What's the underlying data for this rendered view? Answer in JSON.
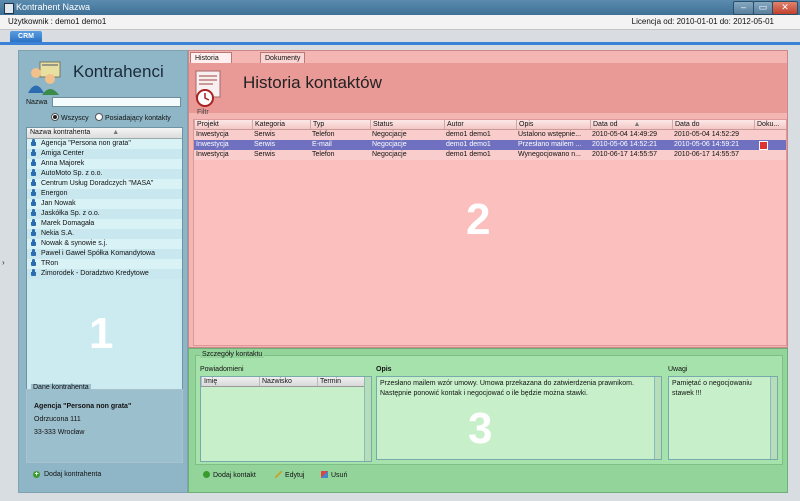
{
  "window": {
    "title": "Kontrahent Nazwa",
    "min": "–",
    "max": "▭",
    "close": "✕"
  },
  "info": {
    "user": "Użytkownik : demo1 demo1",
    "license": "Licencja od: 2010-01-01 do: 2012-05-01"
  },
  "tabs": {
    "crm": "CRM"
  },
  "panel1": {
    "heading": "Kontrahenci",
    "search_label": "Nazwa",
    "search_value": "",
    "radio_all": "Wszyscy",
    "radio_contacts": "Posiadający kontakty",
    "list_header": "Nazwa kontrahenta",
    "sort_icon": "▲",
    "items": [
      "Agencja \"Persona non grata\"",
      "Amiga Center",
      "Anna Majorek",
      "AutoMoto Sp. z o.o.",
      "Centrum Usług Doradczych \"MASA\"",
      "Energon",
      "Jan Nowak",
      "Jaskółka Sp. z o.o.",
      "Marek Domagała",
      "Nekia S.A.",
      "Nowak & synowie s.j.",
      "Paweł i Gaweł Spółka Komandytowa",
      "TRon",
      "Zimorodek - Doradztwo Kredytowe"
    ],
    "number": "1",
    "details_label": "Dane kontrahenta",
    "details_name": "Agencja \"Persona non grata\"",
    "details_street": "Odrzucona 111",
    "details_city": "33-333 Wrocław",
    "add_button": "Dodaj kontrahenta"
  },
  "panel2": {
    "tab_history": "Historia kontaktów",
    "tab_docs": "Dokumenty",
    "heading": "Historia kontaktów",
    "filter_label": "Filtr",
    "sort_icon": "▲",
    "columns": [
      "Projekt",
      "Kategoria",
      "Typ",
      "Status",
      "Autor",
      "Opis",
      "Data od",
      "Data do",
      "Doku..."
    ],
    "rows": [
      [
        "Inwestycja",
        "Serwis",
        "Telefon",
        "Negocjacje",
        "demo1 demo1",
        "Ustalono wstępnie...",
        "2010-05-04 14:49:29",
        "2010-05-04 14:52:29"
      ],
      [
        "Inwestycja",
        "Serwis",
        "E-mail",
        "Negocjacje",
        "demo1 demo1",
        "Przesłano mailem ...",
        "2010-05-06 14:52:21",
        "2010-05-06 14:59:21"
      ],
      [
        "Inwestycja",
        "Serwis",
        "Telefon",
        "Negocjacje",
        "demo1 demo1",
        "Wynegocjowano n...",
        "2010-06-17 14:55:57",
        "2010-06-17 14:55:57"
      ]
    ],
    "number": "2"
  },
  "panel3": {
    "group_label": "Szczegóły kontaktu",
    "notify_label": "Powiadomieni",
    "notify_cols": [
      "Imię",
      "Nazwisko",
      "Termin"
    ],
    "desc_label": "Opis",
    "desc_text": "Przesłano mailem wzór umowy. Umowa przekazana do zatwierdzenia prawnikom. Następnie ponowić kontak i negocjować o ile będzie można stawki.",
    "notes_label": "Uwagi",
    "notes_text": "Pamiętać o negocjowaniu stawek !!!",
    "number": "3",
    "btn_add": "Dodaj kontakt",
    "btn_edit": "Edytuj",
    "btn_delete": "Usuń"
  }
}
